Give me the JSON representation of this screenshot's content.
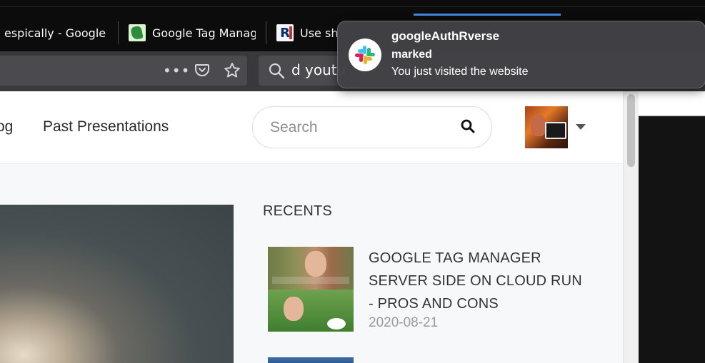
{
  "tabs": [
    {
      "label": "espically - Google",
      "active": false
    },
    {
      "label": "Google Tag Manag",
      "active": false
    },
    {
      "label": "Use sh",
      "active": true
    }
  ],
  "navbar": {
    "url_fragment": "d youtu",
    "icons": [
      "more-icon",
      "pocket-icon",
      "bookmark-star-icon",
      "search-icon"
    ]
  },
  "site": {
    "nav_partial": "og",
    "nav_link": "Past Presentations",
    "search": {
      "placeholder": "Search",
      "value": ""
    }
  },
  "sidebar": {
    "heading": "RECENTS",
    "posts": [
      {
        "title": "GOOGLE TAG MANAGER SERVER SIDE ON CLOUD RUN - PROS AND CONS",
        "date": "2020-08-21"
      }
    ]
  },
  "notification": {
    "app": "googleAuthRverse",
    "subtitle": "marked",
    "body": "You just visited the website",
    "icon": "slack-icon"
  },
  "colors": {
    "tab_accent": "#3f8ae0",
    "notification_bg": "#424246",
    "page_bg": "#f7f8f9"
  }
}
